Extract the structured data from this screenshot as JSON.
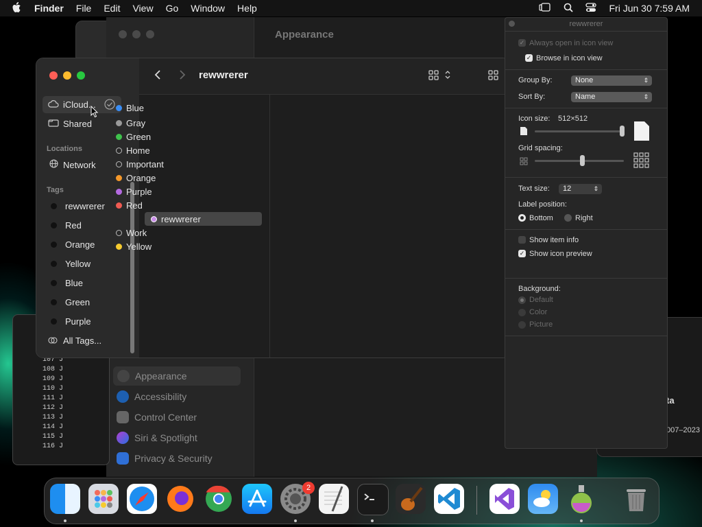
{
  "menubar": {
    "apple": "",
    "app": "Finder",
    "items": [
      "File",
      "Edit",
      "View",
      "Go",
      "Window",
      "Help"
    ],
    "clock": "Fri Jun 30  7:59 AM"
  },
  "settings": {
    "title": "Appearance",
    "sidebar": [
      "Appearance",
      "Accessibility",
      "Control Center",
      "Siri & Spotlight",
      "Privacy & Security"
    ]
  },
  "terminal": {
    "lines": [
      "107 J",
      "108 J",
      "109 J",
      "110 J",
      "111 J",
      "112 J",
      "113 J",
      "114 J",
      "115 J",
      "116 J"
    ]
  },
  "background_text": {
    "right_title": "ta",
    "right_years": "007–2023"
  },
  "finder": {
    "title": "rewwrerer",
    "sidebar": {
      "icloud": "iCloud...",
      "shared": "Shared",
      "locations_header": "Locations",
      "network": "Network",
      "tags_header": "Tags",
      "tags": [
        "rewwrerer",
        "Red",
        "Orange",
        "Yellow",
        "Blue",
        "Green",
        "Purple"
      ],
      "all_tags": "All Tags..."
    },
    "column": [
      {
        "name": "Blue",
        "color": "#3a8ef6"
      },
      {
        "name": "Gray",
        "color": "#9a9a9a"
      },
      {
        "name": "Green",
        "color": "#3fc24c"
      },
      {
        "name": "Home",
        "color": ""
      },
      {
        "name": "Important",
        "color": ""
      },
      {
        "name": "Orange",
        "color": "#f4982a"
      },
      {
        "name": "Purple",
        "color": "#b46ae0"
      },
      {
        "name": "Red",
        "color": "#ef5b52"
      },
      {
        "name": "rewwrerer",
        "color": "#c98de8"
      },
      {
        "name": "Work",
        "color": ""
      },
      {
        "name": "Yellow",
        "color": "#f6cb2f"
      }
    ],
    "selected": "rewwrerer"
  },
  "view_options": {
    "title": "rewwrerer",
    "always_open": "Always open in icon view",
    "browse": "Browse in icon view",
    "group_by_label": "Group By:",
    "group_by_value": "None",
    "sort_by_label": "Sort By:",
    "sort_by_value": "Name",
    "icon_size_label": "Icon size:",
    "icon_size_value": "512×512",
    "icon_size_level": 1.0,
    "grid_spacing_label": "Grid spacing:",
    "grid_spacing_level": 0.5,
    "text_size_label": "Text size:",
    "text_size_value": "12",
    "label_position_label": "Label position:",
    "bottom": "Bottom",
    "right": "Right",
    "show_item_info": "Show item info",
    "show_icon_preview": "Show icon preview",
    "background_label": "Background:",
    "bg_default": "Default",
    "bg_color": "Color",
    "bg_picture": "Picture"
  },
  "dock": {
    "apps": [
      "Finder",
      "Launchpad",
      "Safari",
      "Firefox",
      "Chrome",
      "App Store",
      "System Settings",
      "TextEdit",
      "Terminal",
      "GarageBand",
      "VS Code",
      "Visual Studio",
      "Weather",
      "Installer",
      "Trash"
    ],
    "settings_badge": "2"
  }
}
